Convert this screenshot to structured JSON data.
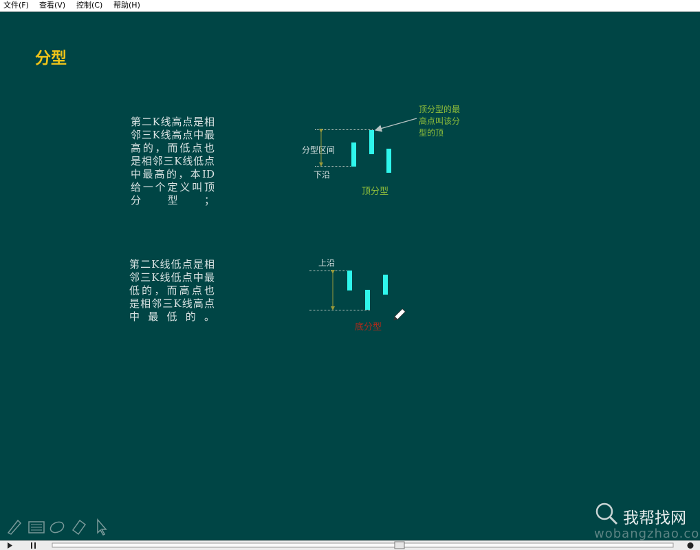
{
  "menubar": {
    "items": [
      {
        "label": "文件(F)"
      },
      {
        "label": "查看(V)"
      },
      {
        "label": "控制(C)"
      },
      {
        "label": "帮助(H)"
      }
    ]
  },
  "slide": {
    "title": "分型",
    "top_pattern": {
      "description_lines": [
        "第二K线高点是相",
        "邻三K线高点中最",
        "高的，而低点也",
        "是相邻三K线低点",
        "中最高的，本ID",
        "给一个定义叫顶",
        "分型；"
      ],
      "annotation_lines": [
        "顶分型的最",
        "高点叫该分",
        "型的顶"
      ],
      "range_label": "分型区间",
      "lower_edge_label": "下沿",
      "caption": "顶分型"
    },
    "bottom_pattern": {
      "description_lines": [
        "第二K线低点是相",
        "邻三K线低点中最",
        "低的，而高点也",
        "是相邻三K线高点",
        "中最低的。"
      ],
      "upper_edge_label": "上沿",
      "caption": "底分型"
    }
  },
  "watermark": {
    "cn": "我帮找网",
    "url": "wobangzhao.com"
  },
  "colors": {
    "background": "#004545",
    "title": "#f0c419",
    "candle": "#2ff6ec",
    "annotation": "#8fbf3a",
    "caption_top": "#8fbf3a",
    "caption_bottom": "#b02a1a",
    "body_text": "#d8e2e2"
  },
  "toolbar_icons": [
    "pen-icon",
    "keyboard-icon",
    "eraser-round-icon",
    "eraser-icon",
    "pointer-icon"
  ],
  "playback_controls": [
    "play-icon",
    "pause-icon",
    "info-icon"
  ]
}
